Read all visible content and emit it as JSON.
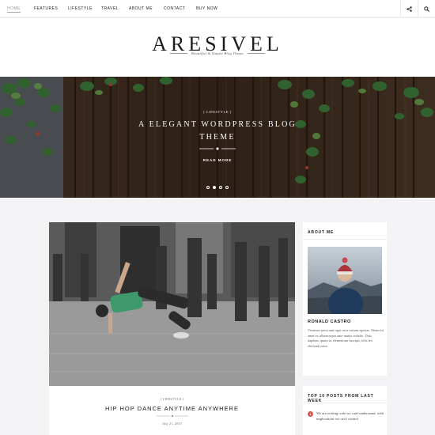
{
  "nav": {
    "items": [
      {
        "label": "Home",
        "active": true
      },
      {
        "label": "Features"
      },
      {
        "label": "Lifestyle"
      },
      {
        "label": "Travel"
      },
      {
        "label": "About Me"
      },
      {
        "label": "Contact"
      },
      {
        "label": "Buy Now"
      }
    ],
    "share_icon": "share-icon",
    "search_icon": "search-icon"
  },
  "header": {
    "logo": "ARESIVEL",
    "tagline": "Beautiful & Simple Blog Theme"
  },
  "hero": {
    "category": "[ LIFESTYLE ]",
    "title_line1": "A Elegant WordPress Blog",
    "title_line2": "Theme",
    "read_more": "READ MORE",
    "slides": 4,
    "active_slide": 2
  },
  "post": {
    "category": "[ LIFESTYLE ]",
    "title": "Hip Hop Dance Anytime Anywhere",
    "date": "July 21, 2015"
  },
  "about": {
    "title": "About Me",
    "name": "Ronald Castro",
    "text": "Vivamus porta ante eget arcu rutrum egestas. Etiam sit amet ex ullamcorper ante mattis sodales. Duis dapibus, quam ac elementum suscipit, felis leo eleifend tortor."
  },
  "top_posts": {
    "title": "Top 10 Posts From Last Week",
    "items": [
      {
        "num": "1",
        "text": "We are writing code we can't understand, with implications we can't control"
      }
    ]
  },
  "colors": {
    "accent": "#d9534f",
    "background": "#f3f3f5"
  }
}
